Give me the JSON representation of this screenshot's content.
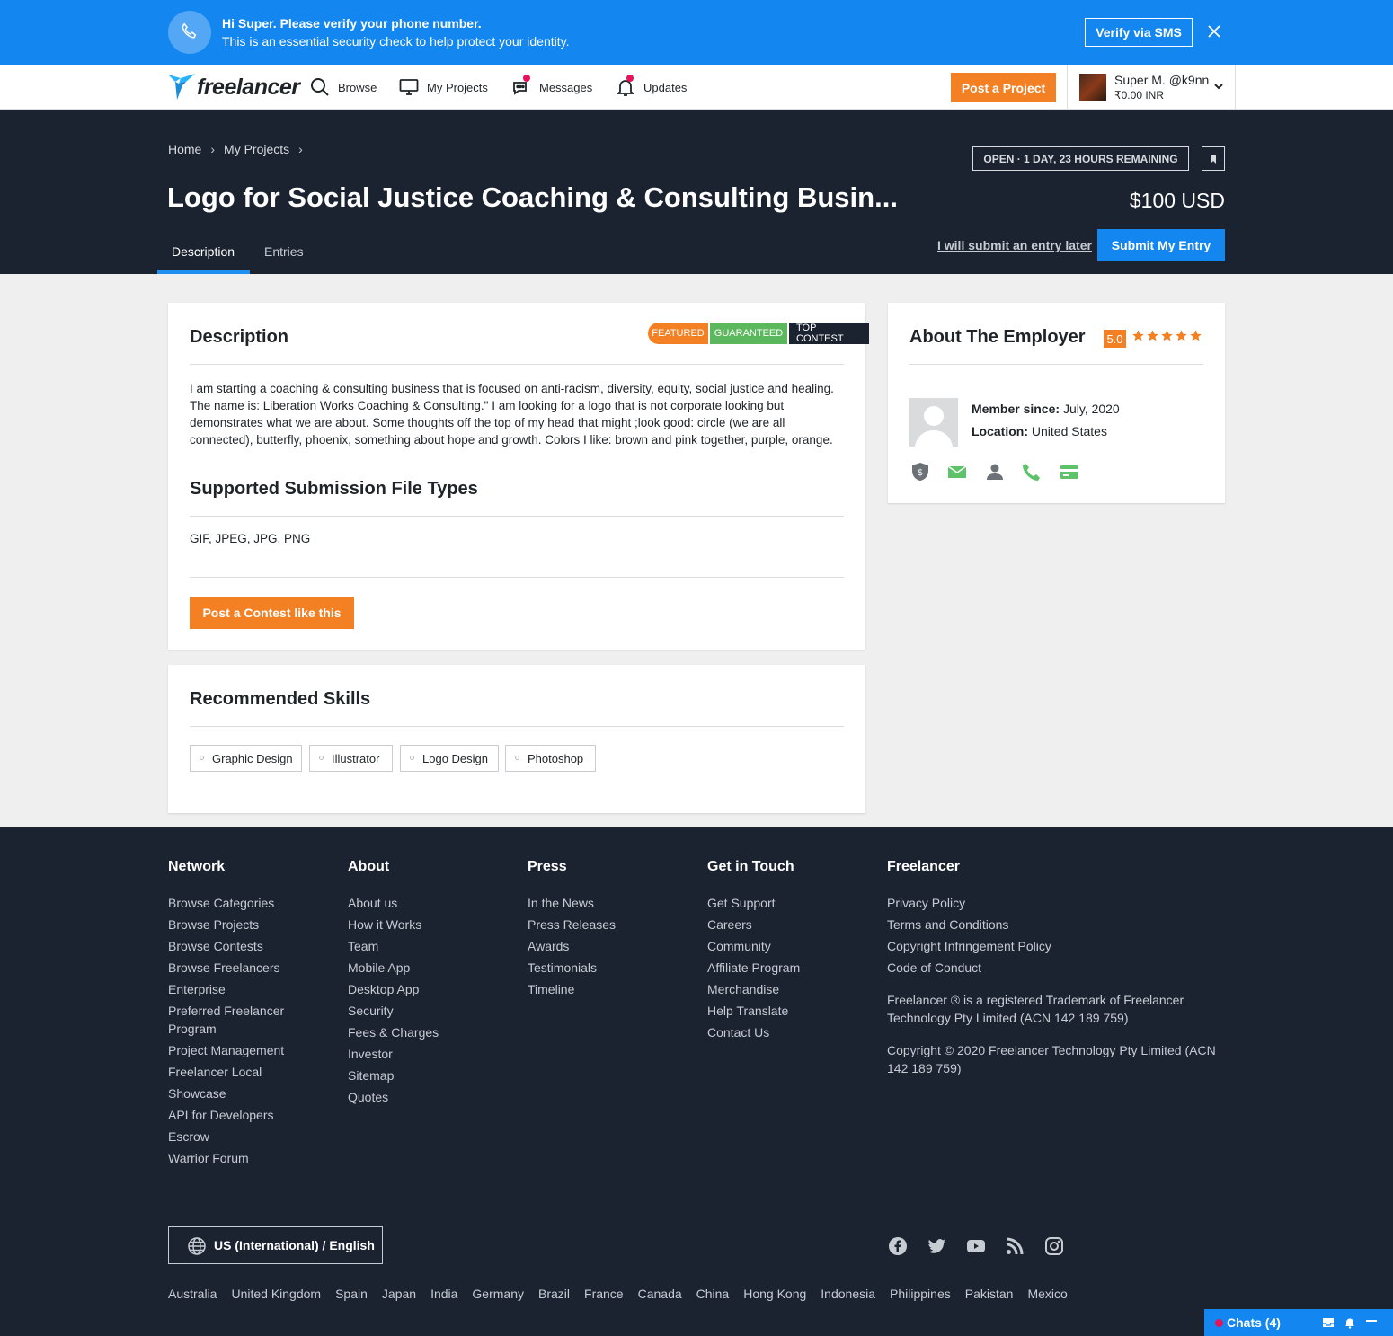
{
  "verify_banner": {
    "title": "Hi Super. Please verify your phone number.",
    "subtitle": "This is an essential security check to help protect your identity.",
    "button": "Verify via SMS",
    "bg_color": "#1386f0"
  },
  "nav": {
    "logo_text": "freelancer",
    "items": [
      "Browse",
      "My Projects",
      "Messages",
      "Updates"
    ],
    "post_button": "Post a Project",
    "user_name": "Super M. @k9nn",
    "user_balance": "₹0.00 INR"
  },
  "header": {
    "breadcrumbs": [
      "Home",
      "My Projects"
    ],
    "status": "OPEN · 1 DAY, 23 HOURS REMAINING",
    "title": "Logo for Social Justice Coaching & Consulting Busin...",
    "price": "$100 USD",
    "tabs": [
      "Description",
      "Entries"
    ],
    "later_link": "I will submit an entry later",
    "submit_button": "Submit My Entry"
  },
  "description_card": {
    "heading": "Description",
    "badges": [
      "FEATURED",
      "GUARANTEED",
      "TOP CONTEST"
    ],
    "text": "I am starting a coaching & consulting business that is focused on anti-racism, diversity, equity, social justice and healing. The name is: Liberation Works Coaching & Consulting.\" I am looking for a logo that is not corporate looking but demonstrates what we are about. Some thoughts off the top of my head that might ;look good: circle (we are all connected), butterfly, phoenix, something about hope and growth. Colors I like: brown and pink together, purple, orange.",
    "filetypes_heading": "Supported Submission File Types",
    "filetypes": "GIF, JPEG, JPG, PNG",
    "post_contest_button": "Post a Contest like this"
  },
  "skills_card": {
    "heading": "Recommended Skills",
    "skills": [
      "Graphic Design",
      "Illustrator",
      "Logo Design",
      "Photoshop"
    ]
  },
  "employer_card": {
    "heading": "About The Employer",
    "rating": "5.0",
    "stars": 5,
    "member_label": "Member since:",
    "member_value": "July, 2020",
    "location_label": "Location:",
    "location_value": "United States",
    "verification_icons": [
      "payment-verified-icon",
      "email-verified-icon",
      "profile-icon",
      "phone-verified-icon",
      "deposit-made-icon"
    ]
  },
  "footer": {
    "columns": [
      {
        "heading": "Network",
        "links": [
          "Browse Categories",
          "Browse Projects",
          "Browse Contests",
          "Browse Freelancers",
          "Enterprise",
          "Preferred Freelancer Program",
          "Project Management",
          "Freelancer Local",
          "Showcase",
          "API for Developers",
          "Escrow",
          "Warrior Forum"
        ]
      },
      {
        "heading": "About",
        "links": [
          "About us",
          "How it Works",
          "Team",
          "Mobile App",
          "Desktop App",
          "Security",
          "Fees & Charges",
          "Investor",
          "Sitemap",
          "Quotes"
        ]
      },
      {
        "heading": "Press",
        "links": [
          "In the News",
          "Press Releases",
          "Awards",
          "Testimonials",
          "Timeline"
        ]
      },
      {
        "heading": "Get in Touch",
        "links": [
          "Get Support",
          "Careers",
          "Community",
          "Affiliate Program",
          "Merchandise",
          "Help Translate",
          "Contact Us"
        ]
      }
    ],
    "freelancer": {
      "heading": "Freelancer",
      "links": [
        "Privacy Policy",
        "Terms and Conditions",
        "Copyright Infringement Policy",
        "Code of Conduct"
      ],
      "trademark": "Freelancer ® is a registered Trademark of Freelancer Technology Pty Limited (ACN 142 189 759)",
      "copyright": "Copyright © 2020 Freelancer Technology Pty Limited (ACN 142 189 759)"
    },
    "language": "US (International) / English",
    "social": [
      "facebook-icon",
      "twitter-icon",
      "youtube-icon",
      "rss-icon",
      "instagram-icon"
    ],
    "countries": [
      "Australia",
      "United Kingdom",
      "Spain",
      "Japan",
      "India",
      "Germany",
      "Brazil",
      "France",
      "Canada",
      "China",
      "Hong Kong",
      "Indonesia",
      "Philippines",
      "Pakistan",
      "Mexico"
    ]
  },
  "chats": {
    "label": "Chats (4)"
  }
}
